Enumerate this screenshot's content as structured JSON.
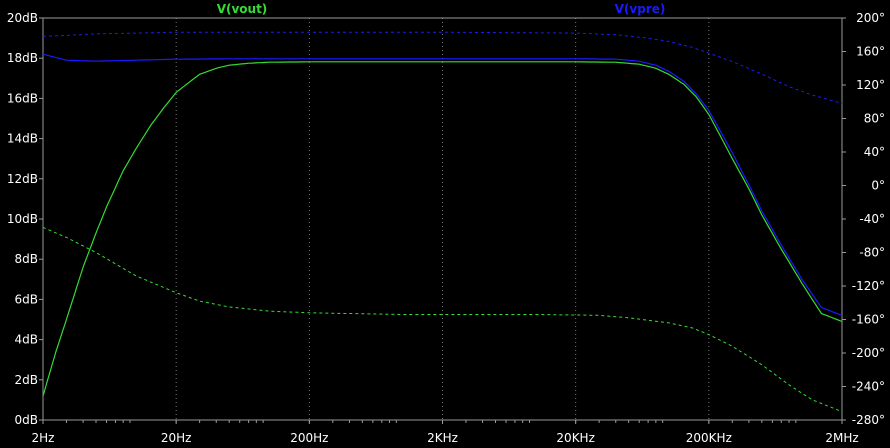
{
  "colors": {
    "background": "#000000",
    "axis": "#9a9a9a",
    "grid": "#7a7a7a",
    "tick_text": "#ffffff",
    "vout": "#33dd33",
    "vpre": "#1a1aff"
  },
  "chart_data": {
    "type": "line",
    "title": "",
    "xlabel": "",
    "ylabel": "",
    "y2label": "",
    "xscale": "log",
    "xlim": [
      2,
      2000000
    ],
    "ylim": [
      0,
      20
    ],
    "y2lim": [
      -280,
      200
    ],
    "grid": "dotted-vertical",
    "legend": "top-center",
    "x_ticks": [
      {
        "value": 2,
        "label": "2Hz"
      },
      {
        "value": 20,
        "label": "20Hz"
      },
      {
        "value": 200,
        "label": "200Hz"
      },
      {
        "value": 2000,
        "label": "2KHz"
      },
      {
        "value": 20000,
        "label": "20KHz"
      },
      {
        "value": 200000,
        "label": "200KHz"
      },
      {
        "value": 2000000,
        "label": "2MHz"
      }
    ],
    "y_ticks": [
      {
        "value": 0,
        "label": "0dB"
      },
      {
        "value": 2,
        "label": "2dB"
      },
      {
        "value": 4,
        "label": "4dB"
      },
      {
        "value": 6,
        "label": "6dB"
      },
      {
        "value": 8,
        "label": "8dB"
      },
      {
        "value": 10,
        "label": "10dB"
      },
      {
        "value": 12,
        "label": "12dB"
      },
      {
        "value": 14,
        "label": "14dB"
      },
      {
        "value": 16,
        "label": "16dB"
      },
      {
        "value": 18,
        "label": "18dB"
      },
      {
        "value": 20,
        "label": "20dB"
      }
    ],
    "y2_ticks": [
      {
        "value": -280,
        "label": "-280°"
      },
      {
        "value": -240,
        "label": "-240°"
      },
      {
        "value": -200,
        "label": "-200°"
      },
      {
        "value": -160,
        "label": "-160°"
      },
      {
        "value": -120,
        "label": "-120°"
      },
      {
        "value": -80,
        "label": "-80°"
      },
      {
        "value": -40,
        "label": "-40°"
      },
      {
        "value": 0,
        "label": "0°"
      },
      {
        "value": 40,
        "label": "40°"
      },
      {
        "value": 80,
        "label": "80°"
      },
      {
        "value": 120,
        "label": "120°"
      },
      {
        "value": 160,
        "label": "160°"
      },
      {
        "value": 200,
        "label": "200°"
      }
    ],
    "series": [
      {
        "name": "V(vout)",
        "color": "#33dd33",
        "magnitude_db": [
          [
            2,
            1.2
          ],
          [
            2.5,
            3.4
          ],
          [
            3,
            5.0
          ],
          [
            4,
            7.6
          ],
          [
            5,
            9.3
          ],
          [
            6,
            10.6
          ],
          [
            8,
            12.4
          ],
          [
            10,
            13.5
          ],
          [
            13,
            14.7
          ],
          [
            16,
            15.5
          ],
          [
            20,
            16.3
          ],
          [
            25,
            16.8
          ],
          [
            30,
            17.2
          ],
          [
            40,
            17.5
          ],
          [
            50,
            17.65
          ],
          [
            70,
            17.75
          ],
          [
            100,
            17.8
          ],
          [
            200,
            17.82
          ],
          [
            2000,
            17.82
          ],
          [
            20000,
            17.82
          ],
          [
            40000,
            17.8
          ],
          [
            60000,
            17.7
          ],
          [
            80000,
            17.5
          ],
          [
            100000,
            17.2
          ],
          [
            130000,
            16.7
          ],
          [
            160000,
            16.1
          ],
          [
            200000,
            15.2
          ],
          [
            250000,
            14.0
          ],
          [
            300000,
            13.0
          ],
          [
            400000,
            11.5
          ],
          [
            500000,
            10.2
          ],
          [
            700000,
            8.5
          ],
          [
            1000000,
            6.8
          ],
          [
            1400000,
            5.3
          ],
          [
            2000000,
            4.9
          ]
        ],
        "phase_deg": [
          [
            2,
            -50
          ],
          [
            3,
            -62
          ],
          [
            5,
            -80
          ],
          [
            10,
            -108
          ],
          [
            20,
            -128
          ],
          [
            30,
            -138
          ],
          [
            50,
            -145
          ],
          [
            100,
            -150
          ],
          [
            200,
            -152
          ],
          [
            1000,
            -154
          ],
          [
            10000,
            -154
          ],
          [
            30000,
            -155
          ],
          [
            50000,
            -158
          ],
          [
            100000,
            -164
          ],
          [
            150000,
            -170
          ],
          [
            200000,
            -178
          ],
          [
            300000,
            -192
          ],
          [
            500000,
            -214
          ],
          [
            800000,
            -238
          ],
          [
            1200000,
            -256
          ],
          [
            2000000,
            -270
          ]
        ]
      },
      {
        "name": "V(vpre)",
        "color": "#1a1aff",
        "magnitude_db": [
          [
            2,
            18.2
          ],
          [
            3,
            17.9
          ],
          [
            5,
            17.85
          ],
          [
            10,
            17.9
          ],
          [
            20,
            17.95
          ],
          [
            50,
            17.97
          ],
          [
            100,
            17.97
          ],
          [
            2000,
            17.97
          ],
          [
            20000,
            17.97
          ],
          [
            40000,
            17.95
          ],
          [
            60000,
            17.85
          ],
          [
            80000,
            17.65
          ],
          [
            100000,
            17.35
          ],
          [
            130000,
            16.85
          ],
          [
            160000,
            16.25
          ],
          [
            200000,
            15.4
          ],
          [
            250000,
            14.25
          ],
          [
            300000,
            13.3
          ],
          [
            400000,
            11.7
          ],
          [
            500000,
            10.4
          ],
          [
            700000,
            8.7
          ],
          [
            1000000,
            7.0
          ],
          [
            1400000,
            5.6
          ],
          [
            2000000,
            5.2
          ]
        ],
        "phase_deg": [
          [
            2,
            178
          ],
          [
            5,
            181
          ],
          [
            20,
            183
          ],
          [
            200,
            183
          ],
          [
            2000,
            183
          ],
          [
            20000,
            182
          ],
          [
            40000,
            180
          ],
          [
            70000,
            176
          ],
          [
            100000,
            172
          ],
          [
            150000,
            165
          ],
          [
            200000,
            158
          ],
          [
            300000,
            148
          ],
          [
            500000,
            133
          ],
          [
            800000,
            118
          ],
          [
            1200000,
            108
          ],
          [
            2000000,
            98
          ]
        ]
      }
    ]
  }
}
